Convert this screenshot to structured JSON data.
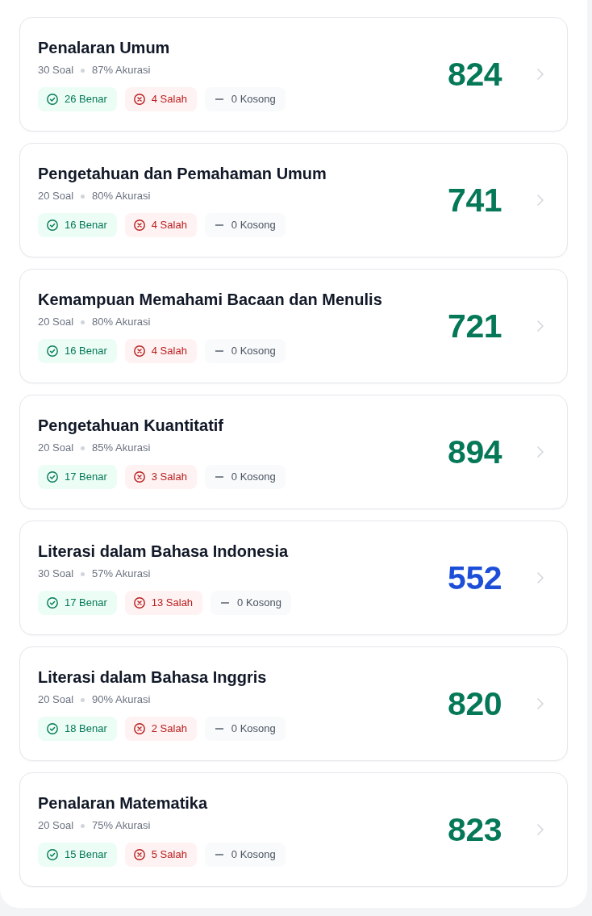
{
  "subjects": [
    {
      "title": "Penalaran Umum",
      "questions": "30 Soal",
      "accuracy": "87% Akurasi",
      "chips": [
        {
          "kind": "correct",
          "label": "26 Benar"
        },
        {
          "kind": "wrong",
          "label": "4 Salah"
        },
        {
          "kind": "empty",
          "label": "0 Kosong"
        }
      ],
      "score": "824",
      "color": "#047857"
    },
    {
      "title": "Pengetahuan dan Pemahaman Umum",
      "questions": "20 Soal",
      "accuracy": "80% Akurasi",
      "chips": [
        {
          "kind": "correct",
          "label": "16 Benar"
        },
        {
          "kind": "wrong",
          "label": "4 Salah"
        },
        {
          "kind": "empty",
          "label": "0 Kosong"
        }
      ],
      "score": "741",
      "color": "#047857"
    },
    {
      "title": "Kemampuan Memahami Bacaan dan Menulis",
      "questions": "20 Soal",
      "accuracy": "80% Akurasi",
      "chips": [
        {
          "kind": "correct",
          "label": "16 Benar"
        },
        {
          "kind": "wrong",
          "label": "4 Salah"
        },
        {
          "kind": "empty",
          "label": "0 Kosong"
        }
      ],
      "score": "721",
      "color": "#047857"
    },
    {
      "title": "Pengetahuan Kuantitatif",
      "questions": "20 Soal",
      "accuracy": "85% Akurasi",
      "chips": [
        {
          "kind": "correct",
          "label": "17 Benar"
        },
        {
          "kind": "wrong",
          "label": "3 Salah"
        },
        {
          "kind": "empty",
          "label": "0 Kosong"
        }
      ],
      "score": "894",
      "color": "#047857"
    },
    {
      "title": "Literasi dalam Bahasa Indonesia",
      "questions": "30 Soal",
      "accuracy": "57% Akurasi",
      "chips": [
        {
          "kind": "correct",
          "label": "17 Benar"
        },
        {
          "kind": "wrong",
          "label": "13 Salah"
        },
        {
          "kind": "empty",
          "label": "0 Kosong"
        }
      ],
      "score": "552",
      "color": "#1d4ed8"
    },
    {
      "title": "Literasi dalam Bahasa Inggris",
      "questions": "20 Soal",
      "accuracy": "90% Akurasi",
      "chips": [
        {
          "kind": "correct",
          "label": "18 Benar"
        },
        {
          "kind": "wrong",
          "label": "2 Salah"
        },
        {
          "kind": "empty",
          "label": "0 Kosong"
        }
      ],
      "score": "820",
      "color": "#047857"
    },
    {
      "title": "Penalaran Matematika",
      "questions": "20 Soal",
      "accuracy": "75% Akurasi",
      "chips": [
        {
          "kind": "correct",
          "label": "15 Benar"
        },
        {
          "kind": "wrong",
          "label": "5 Salah"
        },
        {
          "kind": "empty",
          "label": "0 Kosong"
        }
      ],
      "score": "823",
      "color": "#047857"
    }
  ]
}
